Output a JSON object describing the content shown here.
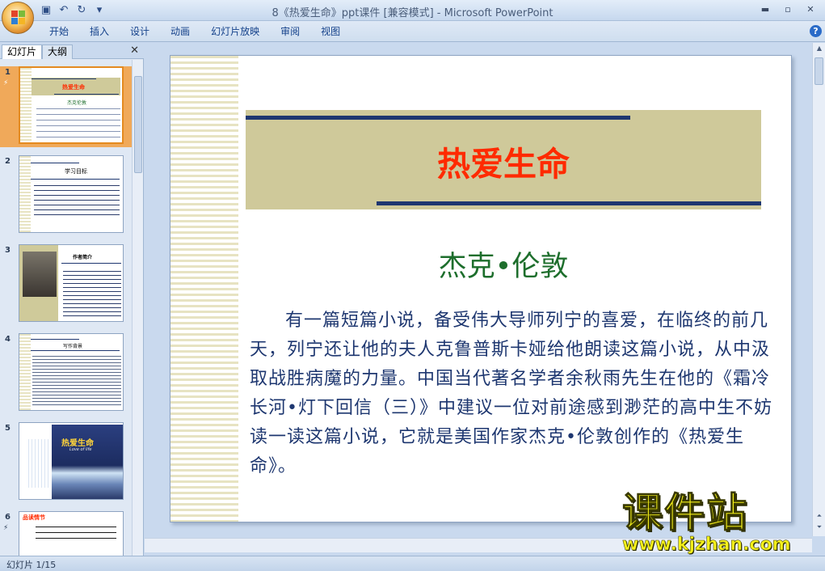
{
  "window": {
    "title": "8《热爱生命》ppt课件 [兼容模式] - Microsoft PowerPoint",
    "controls": [
      "▬",
      "▫",
      "✕"
    ]
  },
  "quick_access": {
    "save_icon": "save-icon",
    "undo_icon": "undo-icon",
    "redo_icon": "redo-icon"
  },
  "ribbon": {
    "tabs": [
      "开始",
      "插入",
      "设计",
      "动画",
      "幻灯片放映",
      "审阅",
      "视图"
    ],
    "help": "?"
  },
  "pane": {
    "tab_slides": "幻灯片",
    "tab_outline": "大纲",
    "close": "✕"
  },
  "thumbnails": [
    {
      "num": "1",
      "title": "热爱生命",
      "subtitle": "杰克伦敦"
    },
    {
      "num": "2",
      "title": "学习目标"
    },
    {
      "num": "3",
      "title": "作者简介"
    },
    {
      "num": "4",
      "title": "写作背景"
    },
    {
      "num": "5",
      "title": "热爱生命",
      "subtitle": "Love of life"
    },
    {
      "num": "6",
      "title": "品读情节"
    }
  ],
  "slide": {
    "title": "热爱生命",
    "author": "杰克•伦敦",
    "body": "有一篇短篇小说，备受伟大导师列宁的喜爱，在临终的前几天，列宁还让他的夫人克鲁普斯卡娅给他朗读这篇小说，从中汲取战胜病魔的力量。中国当代著名学者余秋雨先生在他的《霜冷长河•灯下回信（三）》中建议一位对前途感到渺茫的高中生不妨读一读这篇小说，它就是美国作家杰克•伦敦创作的《热爱生命》。"
  },
  "watermark": {
    "brand": "课件站",
    "url": "www.kjzhan.com"
  },
  "status": {
    "slide_counter": "幻灯片 1/15"
  }
}
